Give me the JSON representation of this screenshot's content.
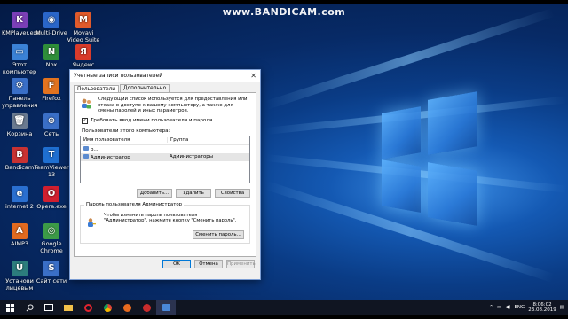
{
  "watermark": "www.BANDICAM.com",
  "desktop_icons": [
    {
      "label": "KMPlayer.exe",
      "glyph": "K",
      "color": "#7a3fb7"
    },
    {
      "label": "Multi-Drive",
      "glyph": "◉",
      "color": "#2a66c9"
    },
    {
      "label": "Movavi Video Suite",
      "glyph": "M",
      "color": "#e05a2b"
    },
    {
      "label": "Этот компьютер",
      "glyph": "▭",
      "color": "#3b82d6"
    },
    {
      "label": "Nox",
      "glyph": "N",
      "color": "#2f8e3a"
    },
    {
      "label": "Яндекс",
      "glyph": "Я",
      "color": "#d93b2b"
    },
    {
      "label": "Панель управления",
      "glyph": "⚙",
      "color": "#3a6fc7"
    },
    {
      "label": "Firefox",
      "glyph": "F",
      "color": "#e2731f"
    },
    {
      "label": "Корзина",
      "glyph": "🗑",
      "color": "#6a7a90"
    },
    {
      "label": "Сеть",
      "glyph": "⊕",
      "color": "#3a6fc7"
    },
    {
      "label": "Bandicam",
      "glyph": "B",
      "color": "#c83232"
    },
    {
      "label": "TeamViewer 13",
      "glyph": "T",
      "color": "#1f6fd1"
    },
    {
      "label": "internet 2",
      "glyph": "e",
      "color": "#2a6fcf"
    },
    {
      "label": "Opera.exe",
      "glyph": "O",
      "color": "#d11f2f"
    },
    {
      "label": "AIMP3",
      "glyph": "A",
      "color": "#e26a1f"
    },
    {
      "label": "Google Chrome",
      "glyph": "◎",
      "color": "#3c9b47"
    },
    {
      "label": "Установи лицевым",
      "glyph": "U",
      "color": "#2c7d7d"
    },
    {
      "label": "Сайт сети",
      "glyph": "S",
      "color": "#3a6fc7"
    }
  ],
  "dialog": {
    "title": "Учетные записи пользователей",
    "tabs": [
      "Пользователи",
      "Дополнительно"
    ],
    "info_text": "Следующий список используется для предоставления или отказа в доступе к вашему компьютеру, а также для смены паролей и иных параметров.",
    "require_password_label": "Требовать ввод имени пользователя и пароля.",
    "require_password_checked": "✓",
    "users_section_label": "Пользователи этого компьютера:",
    "columns": {
      "username": "Имя пользователя",
      "group": "Группа"
    },
    "rows": [
      {
        "username": "b...",
        "group": ""
      },
      {
        "username": "Администратор",
        "group": "Администраторы"
      }
    ],
    "buttons": {
      "add": "Добавить...",
      "remove": "Удалить",
      "properties": "Свойства"
    },
    "password_group_title": "Пароль пользователя Администратор",
    "password_text": "Чтобы изменить пароль пользователя \"Администратор\", нажмите кнопку \"Сменить пароль\".",
    "change_password": "Сменить пароль...",
    "ok": "OK",
    "cancel": "Отмена",
    "apply": "Применить"
  },
  "taskbar": {
    "language": "ENG",
    "time": "8:06:02",
    "date": "23.08.2019"
  }
}
